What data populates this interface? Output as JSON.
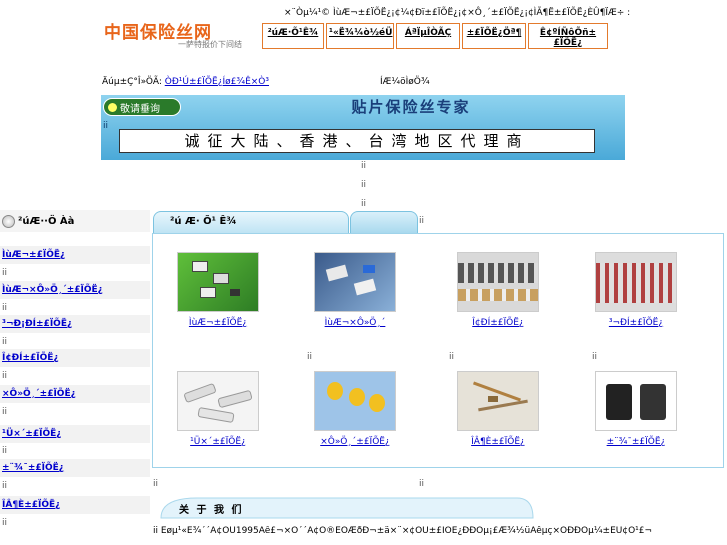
{
  "header": {
    "logo_text": "中国保险丝网",
    "logo_sub": "一萨特报价下间结",
    "top_line": "×¨Òµ¼¹©  ÌùÆ¬±£ÏÕË¿¡¢¼¢Ðï±£ÏÕË¿¡¢×Ô¸´±£ÏÕË¿¡¢ÌÃ¶Ë±£ÏÕË¿ÈÛ¶ÏÆ÷ :",
    "nav": [
      "²úÆ·Õ¹Ê¾",
      "¹«Ë¾¼ò½éÜ",
      "ÁªÏµÎÒÃÇ",
      "±£ÏÕË¿Öª¶",
      "Ê¢ºÍÑôÕñ±£ÏÕË¿"
    ]
  },
  "location": {
    "label": "Äúµ±Ç°Î»ÖÃ:",
    "path": "ÒÐ¹Ú±£ÏÕË¿Íø£¾Ê×Ò³",
    "title": "ÍÆ¼öÌøÖ¾"
  },
  "banner": {
    "button_label": "敬请垂询",
    "title": "贴片保险丝专家",
    "mark": "ii",
    "recruit_text": "诚征大陆、香港、台湾地区代理商"
  },
  "spacer": "ii",
  "sidebar": {
    "title": "²úÆ··Ö Àà",
    "items": [
      "ÌùÆ¬±£ÏÕË¿",
      "ÌùÆ¬×Ô»Ö¸´±£ÏÕË¿",
      "³¬Ð¡ÐÍ±£ÏÕË¿",
      "Î¢ÐÍ±£ÏÕË¿",
      "×Ô»Ö¸´±£ÏÕË¿",
      "¹Ü×´±£ÏÕË¿",
      "±¨¾¯±£ÏÕË¿",
      "ÎÂ¶È±£ÏÕË¿"
    ],
    "gap": "ii"
  },
  "products": {
    "tab_label": "²ú Æ· Õ¹ Ê¾",
    "tick": "ii",
    "items": [
      {
        "label": "ÌùÆ¬±£ÏÕË¿"
      },
      {
        "label": "ÌùÆ¬×Ô»Ö¸´"
      },
      {
        "label": "Î¢ÐÍ±£ÏÕË¿"
      },
      {
        "label": "³¬ÐÍ±£ÏÕË¿"
      },
      {
        "label": "¹Ü×´±£ÏÕË¿"
      },
      {
        "label": "×Ô»Ö¸´±£ÏÕË¿"
      },
      {
        "label": "ÎÂ¶È±£ÏÕË¿"
      },
      {
        "label": "±¨¾¯±£ÏÕË¿"
      }
    ]
  },
  "about": {
    "title": "关 于 我 们",
    "text": "ii Ëøµ¹«Ë¾´´Á¢ÓÚ1995Äê£¬×Ô´´Á¢Ò®ÈÕÆðÐ¬±ä×¨×¢ÓÚ±£ÏÕË¿ÐÐÒµ¡£Æ¾½üÄêµç×ÓÐÐÒµ¼±ËÙ¢Õ¹£¬"
  },
  "colors": {
    "accent": "#e8651a",
    "banner": "#5ab3dc",
    "panel_border": "#9fd3ea"
  }
}
